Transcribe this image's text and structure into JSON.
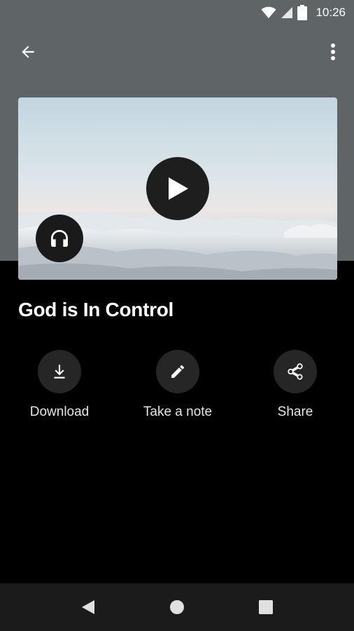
{
  "status_bar": {
    "time": "10:26",
    "icons": [
      "wifi-icon",
      "cell-signal-icon",
      "battery-icon"
    ]
  },
  "app_bar": {
    "back_icon": "arrow-left-icon",
    "menu_icon": "more-vertical-icon"
  },
  "media": {
    "thumbnail": "clouds-sky-image",
    "play_icon": "play-icon",
    "audio_icon": "headphones-icon"
  },
  "title": "God is In Control",
  "actions": [
    {
      "label": "Download",
      "icon": "download-icon"
    },
    {
      "label": "Take a note",
      "icon": "pencil-icon"
    },
    {
      "label": "Share",
      "icon": "share-icon"
    }
  ],
  "nav_bar": {
    "buttons": [
      "back-triangle-icon",
      "home-circle-icon",
      "recents-square-icon"
    ]
  },
  "colors": {
    "header_bg": "#5f6467",
    "page_bg": "#000000",
    "action_circle": "#262626",
    "nav_bg": "#1b1b1b"
  }
}
